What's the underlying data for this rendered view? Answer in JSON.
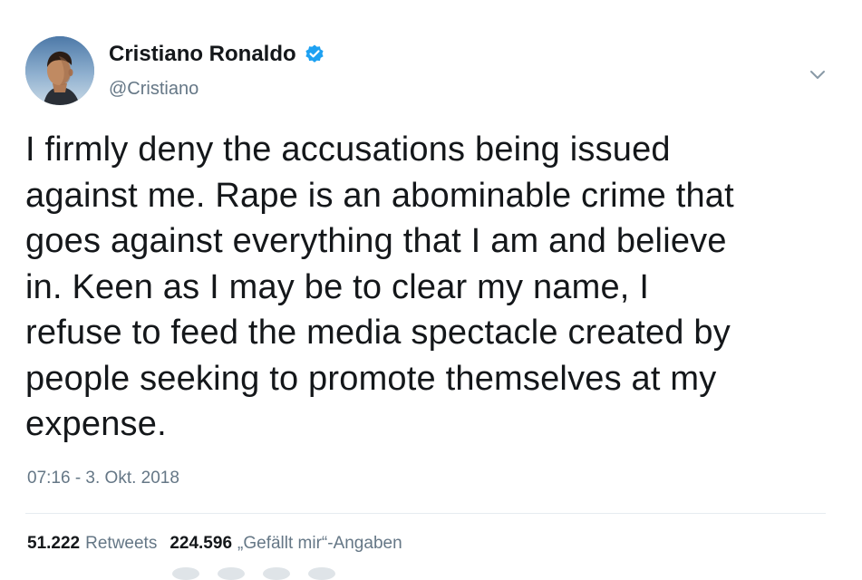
{
  "author": {
    "display_name": "Cristiano Ronaldo",
    "handle": "@Cristiano",
    "verified": true
  },
  "icons": {
    "verified": "verified-badge-icon",
    "caret": "chevron-down-icon",
    "avatar": "profile-photo"
  },
  "colors": {
    "verified_blue": "#1da1f2",
    "secondary_text": "#657786",
    "primary_text": "#14171a",
    "divider": "#e6ecf0"
  },
  "tweet": {
    "lines": [
      "I firmly deny the accusations being issued",
      "against me. Rape is an abominable crime that",
      "goes against everything that I am and believe",
      "in. Keen as I may be to clear my name, I",
      "refuse to feed the media spectacle created by",
      "people seeking to promote themselves at my",
      "expense."
    ],
    "timestamp": "07:16 - 3. Okt. 2018"
  },
  "stats": {
    "retweets_count": "51.222",
    "retweets_label": "Retweets",
    "likes_count": "224.596",
    "likes_label": "„Gefällt mir“-Angaben"
  }
}
